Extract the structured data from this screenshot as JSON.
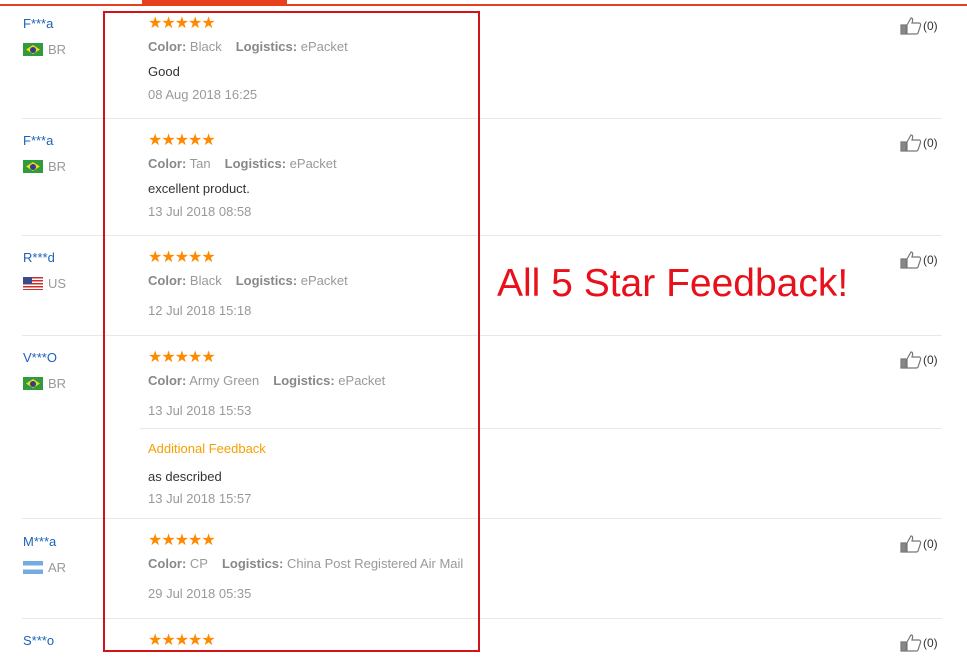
{
  "callout": "All 5 Star Feedback!",
  "colors": {
    "accent": "#e8401f",
    "star": "#ff8a00",
    "name": "#1d62b8",
    "highlight": "#d0141a",
    "additional": "#f5a000"
  },
  "labels": {
    "color": "Color:",
    "logistics": "Logistics:",
    "additional_feedback": "Additional Feedback"
  },
  "reviews": [
    {
      "name": "F***a",
      "country": "BR",
      "flag": "brazil-flag",
      "rating": 5,
      "stars": "★★★★★",
      "color": "Black",
      "logistics": "ePacket",
      "text": "Good",
      "date": "08 Aug 2018 16:25",
      "likes": "(0)"
    },
    {
      "name": "F***a",
      "country": "BR",
      "flag": "brazil-flag",
      "rating": 5,
      "stars": "★★★★★",
      "color": "Tan",
      "logistics": "ePacket",
      "text": "excellent product.",
      "date": "13 Jul 2018 08:58",
      "likes": "(0)"
    },
    {
      "name": "R***d",
      "country": "US",
      "flag": "usa-flag",
      "rating": 5,
      "stars": "★★★★★",
      "color": "Black",
      "logistics": "ePacket",
      "text": "",
      "date": "12 Jul 2018 15:18",
      "likes": "(0)"
    },
    {
      "name": "V***O",
      "country": "BR",
      "flag": "brazil-flag",
      "rating": 5,
      "stars": "★★★★★",
      "color": "Army Green",
      "logistics": "ePacket",
      "text": "",
      "date": "13 Jul 2018 15:53",
      "likes": "(0)",
      "additional": {
        "text": "as described",
        "date": "13 Jul 2018 15:57"
      }
    },
    {
      "name": "M***a",
      "country": "AR",
      "flag": "argentina-flag",
      "rating": 5,
      "stars": "★★★★★",
      "color": "CP",
      "logistics": "China Post Registered Air Mail",
      "text": "",
      "date": "29 Jul 2018 05:35",
      "likes": "(0)"
    },
    {
      "name": "S***o",
      "country": "",
      "flag": "",
      "rating": 5,
      "stars": "★★★★★",
      "likes": "(0)"
    }
  ]
}
